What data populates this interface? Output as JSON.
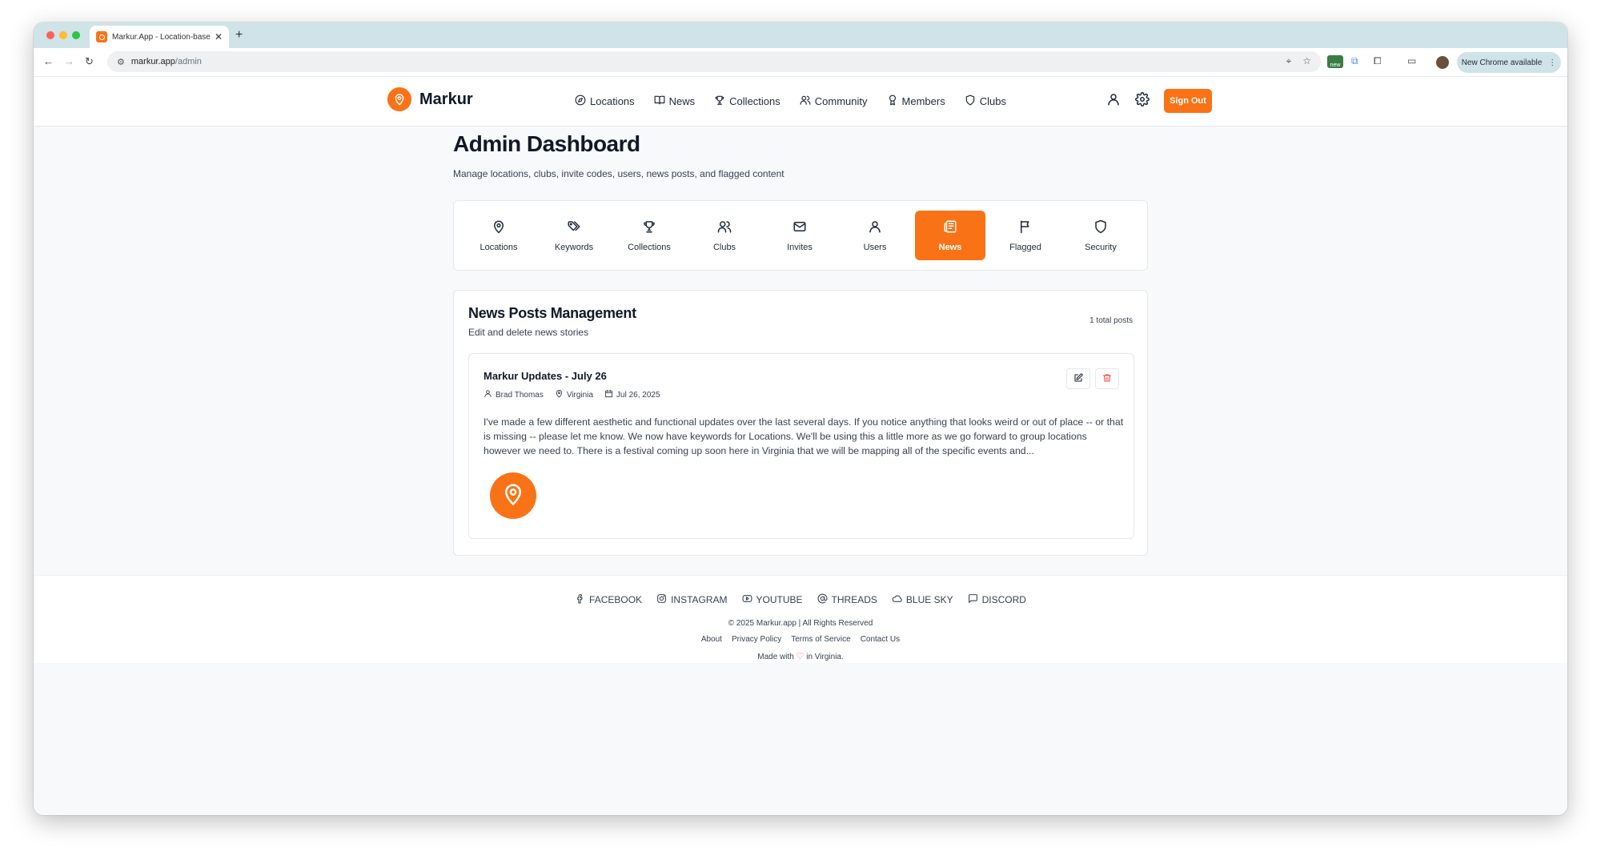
{
  "browser": {
    "tab_title": "Markur.App - Location-based",
    "url_host": "markur.app",
    "url_path": "/admin",
    "update_label": "New Chrome available",
    "ext_badge": "new"
  },
  "header": {
    "brand": "Markur",
    "nav": [
      {
        "label": "Locations",
        "icon": "compass-icon"
      },
      {
        "label": "News",
        "icon": "book-icon"
      },
      {
        "label": "Collections",
        "icon": "trophy-icon"
      },
      {
        "label": "Community",
        "icon": "users-icon"
      },
      {
        "label": "Members",
        "icon": "award-icon"
      },
      {
        "label": "Clubs",
        "icon": "shield-icon"
      }
    ],
    "signout_label": "Sign Out"
  },
  "page": {
    "title": "Admin Dashboard",
    "subtitle": "Manage locations, clubs, invite codes, users, news posts, and flagged content"
  },
  "admin_tabs": [
    {
      "label": "Locations",
      "icon": "map-pin-icon",
      "active": false
    },
    {
      "label": "Keywords",
      "icon": "tags-icon",
      "active": false
    },
    {
      "label": "Collections",
      "icon": "trophy-icon",
      "active": false
    },
    {
      "label": "Clubs",
      "icon": "users-icon",
      "active": false
    },
    {
      "label": "Invites",
      "icon": "mail-icon",
      "active": false
    },
    {
      "label": "Users",
      "icon": "user-icon",
      "active": false
    },
    {
      "label": "News",
      "icon": "newspaper-icon",
      "active": true
    },
    {
      "label": "Flagged",
      "icon": "flag-icon",
      "active": false
    },
    {
      "label": "Security",
      "icon": "shield-icon",
      "active": false
    }
  ],
  "news": {
    "title": "News Posts Management",
    "subtitle": "Edit and delete news stories",
    "count_label": "1 total posts",
    "posts": [
      {
        "title": "Markur Updates - July 26",
        "author": "Brad Thomas",
        "location": "Virginia",
        "date": "Jul 26, 2025",
        "excerpt": "I've made a few different aesthetic and functional updates over the last several days. If you notice anything that looks weird or out of place -- or that is missing -- please let me know. We now have keywords for Locations. We'll be using this a little more as we go forward to group locations however we need to. There is a festival coming up soon here in Virginia that we will be mapping all of the specific events and..."
      }
    ]
  },
  "footer": {
    "social": [
      {
        "label": "FACEBOOK",
        "icon": "facebook-icon"
      },
      {
        "label": "INSTAGRAM",
        "icon": "instagram-icon"
      },
      {
        "label": "YOUTUBE",
        "icon": "youtube-icon"
      },
      {
        "label": "THREADS",
        "icon": "at-sign-icon"
      },
      {
        "label": "BLUE SKY",
        "icon": "cloud-icon"
      },
      {
        "label": "DISCORD",
        "icon": "message-icon"
      }
    ],
    "copyright": "© 2025 Markur.app | All Rights Reserved",
    "links": [
      "About",
      "Privacy Policy",
      "Terms of Service",
      "Contact Us"
    ],
    "made_prefix": "Made with",
    "made_suffix": "in Virginia."
  },
  "colors": {
    "accent": "#f97316",
    "danger": "#ef4444",
    "background": "#f8f9fb"
  }
}
